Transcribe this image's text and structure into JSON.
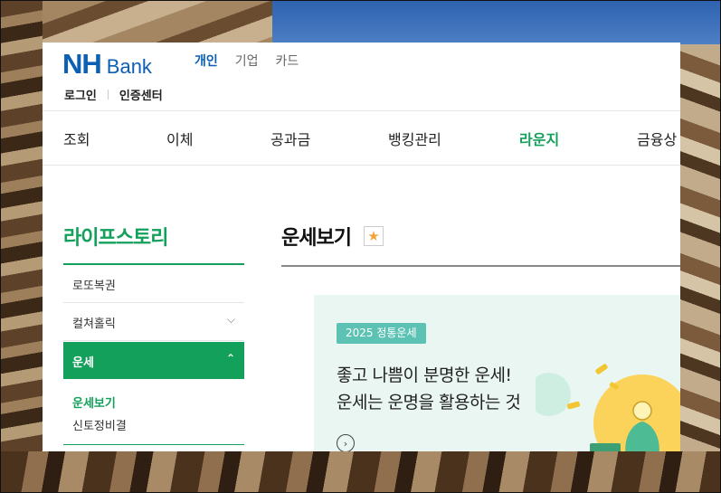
{
  "brand": {
    "nh": "NH",
    "bank": "Bank"
  },
  "top_categories": [
    {
      "label": "개인",
      "active": true
    },
    {
      "label": "기업",
      "active": false
    },
    {
      "label": "카드",
      "active": false
    }
  ],
  "utility": {
    "login": "로그인",
    "cert_center": "인증센터"
  },
  "gnb": [
    {
      "label": "조회"
    },
    {
      "label": "이체"
    },
    {
      "label": "공과금"
    },
    {
      "label": "뱅킹관리"
    },
    {
      "label": "라운지",
      "active": true
    },
    {
      "label": "금융상"
    }
  ],
  "lnb": {
    "title": "라이프스토리",
    "items": [
      {
        "label": "로또복권"
      },
      {
        "label": "컬쳐홀릭",
        "chevron": "⌵"
      },
      {
        "label": "운세",
        "chevron": "⌃",
        "active": true
      }
    ],
    "sub_items": [
      {
        "label": "운세보기",
        "active": true
      },
      {
        "label": "신토정비결"
      }
    ]
  },
  "content": {
    "title": "운세보기",
    "favorite_icon": "★",
    "banner": {
      "badge": "2025 정통운세",
      "line1": "좋고 나쁨이 분명한 운세!",
      "line2": "운세는 운명을 활용하는 것",
      "more_icon": "›"
    }
  },
  "colors": {
    "green": "#13a05a",
    "nh_blue": "#0b5fb5",
    "banner_bg": "#e9f6f1",
    "badge_bg": "#5cc2b3"
  }
}
